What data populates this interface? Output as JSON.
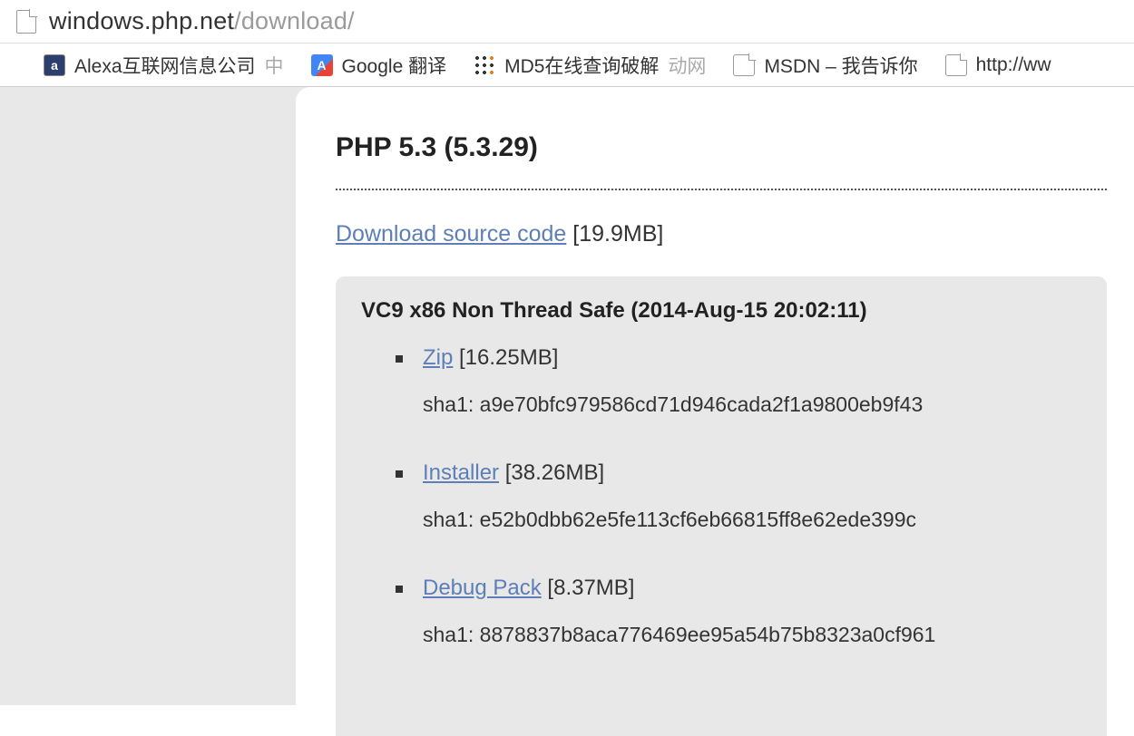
{
  "url": {
    "host": "windows.php.net",
    "path": "/download/"
  },
  "bookmarks": {
    "alexa": {
      "label": "Alexa互联网信息公司",
      "trail": "中"
    },
    "google": {
      "label": "Google 翻译"
    },
    "md5": {
      "label": "MD5在线查询破解",
      "trail": "动网"
    },
    "msdn": {
      "label": "MSDN – 我告诉你"
    },
    "last": {
      "label": "http://ww"
    }
  },
  "page": {
    "heading": "PHP 5.3 (5.3.29)",
    "source_link": "Download source code",
    "source_size": "[19.9MB]",
    "section_title": "VC9 x86 Non Thread Safe (2014-Aug-15 20:02:11)",
    "downloads": [
      {
        "name": "Zip",
        "size": "[16.25MB]",
        "sha1": "sha1: a9e70bfc979586cd71d946cada2f1a9800eb9f43"
      },
      {
        "name": "Installer",
        "size": "[38.26MB]",
        "sha1": "sha1: e52b0dbb62e5fe113cf6eb66815ff8e62ede399c"
      },
      {
        "name": "Debug Pack",
        "size": "[8.37MB]",
        "sha1": "sha1: 8878837b8aca776469ee95a54b75b8323a0cf961"
      }
    ]
  }
}
